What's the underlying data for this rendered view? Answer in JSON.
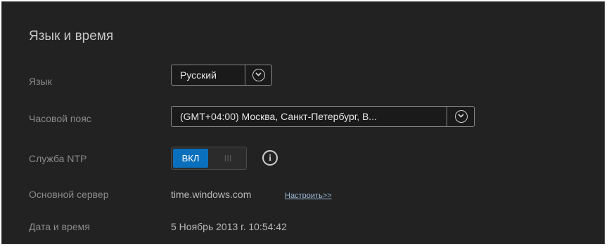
{
  "section": {
    "title": "Язык и время"
  },
  "language": {
    "label": "Язык",
    "value": "Русский",
    "chevron_icon": "chevron-down-circle-icon"
  },
  "timezone": {
    "label": "Часовой пояс",
    "value": "(GMT+04:00) Москва, Санкт-Петербург, В...",
    "chevron_icon": "chevron-down-circle-icon"
  },
  "ntp": {
    "label": "Служба NTP",
    "toggle_on_label": "ВКЛ",
    "toggle_off_label": "III",
    "state": "on",
    "accent_color": "#0a70bd",
    "info_icon": "info-icon"
  },
  "server": {
    "label": "Основной сервер",
    "value": "time.windows.com",
    "configure_link": "Настроить>>"
  },
  "datetime": {
    "label": "Дата и время",
    "value": "5 Ноябрь 2013 г. 10:54:42"
  },
  "info_glyph": "i"
}
